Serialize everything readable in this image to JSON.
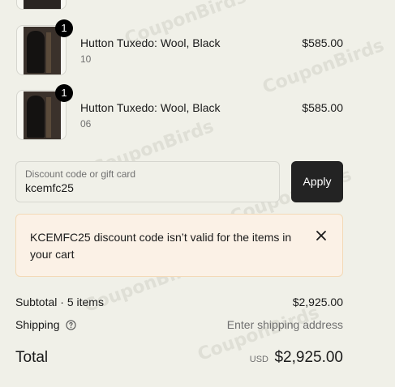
{
  "watermark": "CouponBirds",
  "line_items": [
    {
      "quantity": "1",
      "title": "Hutton Tuxedo: Wool, Black",
      "variant": "10",
      "price": "$585.00"
    },
    {
      "quantity": "1",
      "title": "Hutton Tuxedo: Wool, Black",
      "variant": "06",
      "price": "$585.00"
    }
  ],
  "discount": {
    "label": "Discount code or gift card",
    "value": "kcemfc25",
    "apply_label": "Apply"
  },
  "error": {
    "message": "KCEMFC25 discount code isn’t valid for the items in your cart",
    "icon": "close-icon"
  },
  "summary": {
    "subtotal_label": "Subtotal · 5 items",
    "subtotal_value": "$2,925.00",
    "shipping_label": "Shipping",
    "shipping_icon": "help-circle-icon",
    "shipping_value": "Enter shipping address",
    "total_label": "Total",
    "total_currency": "USD",
    "total_value": "$2,925.00"
  }
}
